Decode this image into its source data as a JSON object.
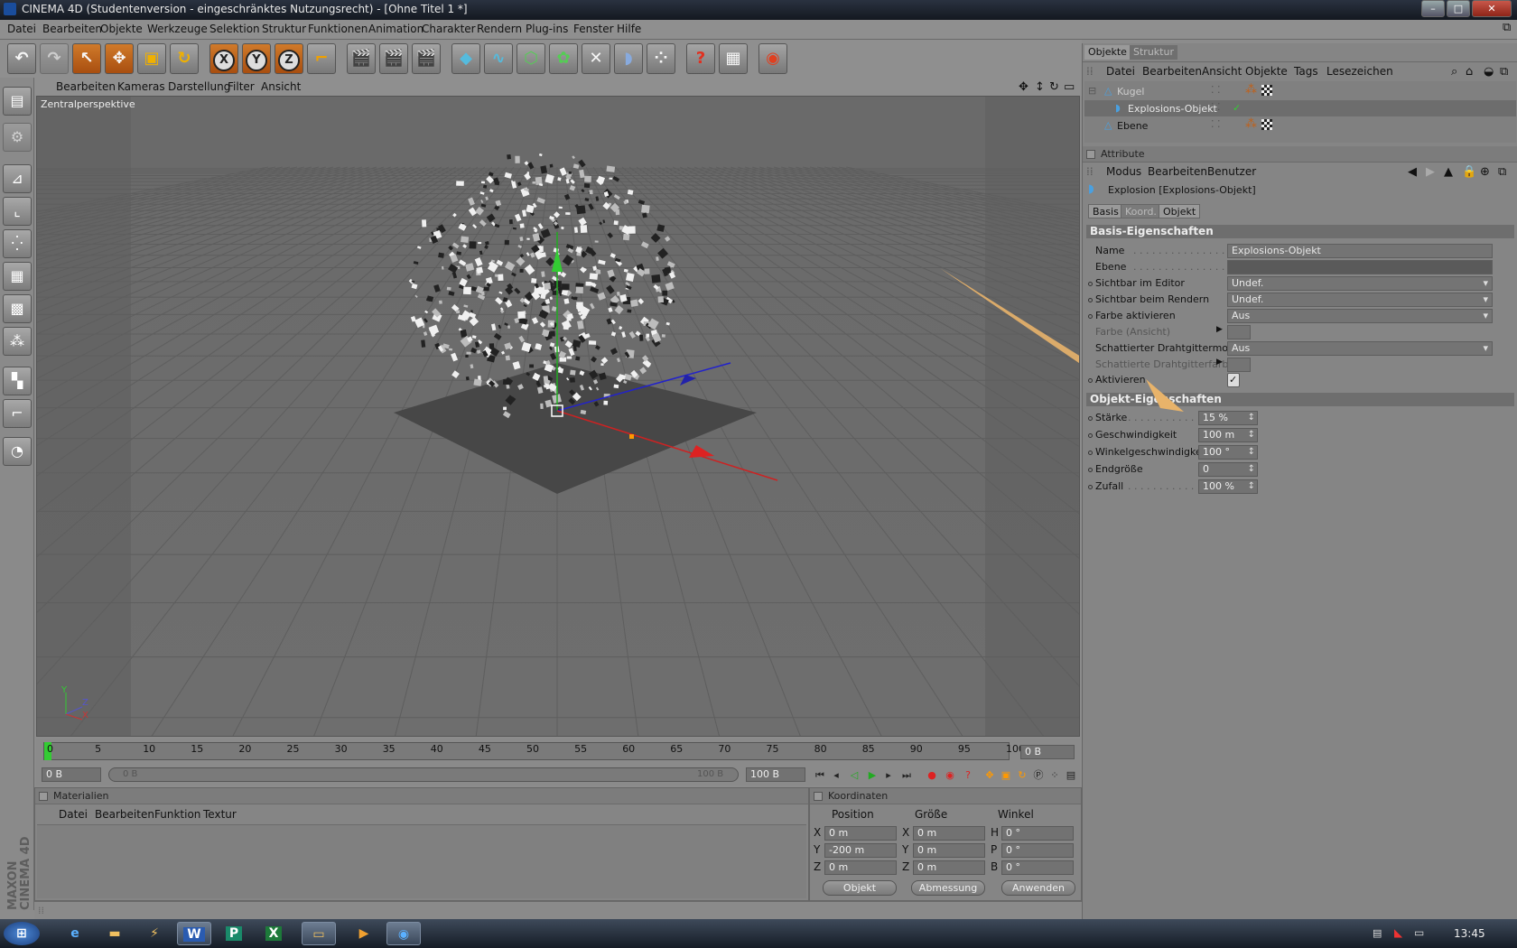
{
  "window": {
    "title": "CINEMA 4D (Studentenversion - eingeschränktes Nutzungsrecht) - [Ohne Titel 1 *]",
    "buttons": [
      "–",
      "□",
      "✕"
    ]
  },
  "menubar": {
    "items": [
      "Datei",
      "Bearbeiten",
      "Objekte",
      "Werkzeuge",
      "Selektion",
      "Struktur",
      "Funktionen",
      "Animation",
      "Charakter",
      "Rendern",
      "Plug-ins",
      "Fenster",
      "Hilfe"
    ]
  },
  "toolbar": {
    "axis_x": "X",
    "axis_y": "Y",
    "axis_z": "Z",
    "tools": [
      "undo-icon",
      "redo-icon",
      "select-arrow-icon",
      "move-icon",
      "scale-icon",
      "rotate-icon",
      "x-axis-icon",
      "y-axis-icon",
      "z-axis-icon",
      "coordinate-system-icon",
      "render-view-icon",
      "render-picture-icon",
      "render-settings-icon",
      "cube-icon",
      "spline-icon",
      "nurbs-icon",
      "modeling-icon",
      "deformer-icon",
      "scene-icon",
      "particle-icon",
      "help-icon",
      "script-icon",
      "browser-icon"
    ]
  },
  "viewport": {
    "menu": [
      "Bearbeiten",
      "Kameras",
      "Darstellung",
      "Filter",
      "Ansicht"
    ],
    "label": "Zentralperspektive",
    "axis_y": "Y",
    "axis_z": "Z",
    "axis_x": "X"
  },
  "timeline": {
    "ticks": [
      "0",
      "5",
      "10",
      "15",
      "20",
      "25",
      "30",
      "35",
      "40",
      "45",
      "50",
      "55",
      "60",
      "65",
      "70",
      "75",
      "80",
      "85",
      "90",
      "95",
      "100"
    ],
    "current_frame": "0 B",
    "start": "0 B",
    "slider_start": "0 B",
    "slider_end": "100 B",
    "end": "100 B"
  },
  "materials": {
    "title": "Materialien",
    "menu": [
      "Datei",
      "Bearbeiten",
      "Funktion",
      "Textur"
    ]
  },
  "coordinates": {
    "title": "Koordinaten",
    "headers": [
      "Position",
      "Größe",
      "Winkel"
    ],
    "rows": [
      {
        "axis": "X",
        "pos": "0 m",
        "size_axis": "X",
        "size": "0 m",
        "rot_axis": "H",
        "rot": "0 °"
      },
      {
        "axis": "Y",
        "pos": "-200 m",
        "size_axis": "Y",
        "size": "0 m",
        "rot_axis": "P",
        "rot": "0 °"
      },
      {
        "axis": "Z",
        "pos": "0 m",
        "size_axis": "Z",
        "size": "0 m",
        "rot_axis": "B",
        "rot": "0 °"
      }
    ],
    "mode": "Objekt",
    "size_mode": "Abmessung",
    "apply": "Anwenden"
  },
  "object_manager": {
    "tabs": [
      "Objekte",
      "Struktur"
    ],
    "menu": [
      "Datei",
      "Bearbeiten",
      "Ansicht",
      "Objekte",
      "Tags",
      "Lesezeichen"
    ],
    "objects": [
      {
        "name": "Kugel"
      },
      {
        "name": "Explosions-Objekt"
      },
      {
        "name": "Ebene"
      }
    ]
  },
  "attributes": {
    "title": "Attribute",
    "menu": [
      "Modus",
      "Bearbeiten",
      "Benutzer"
    ],
    "object_title": "Explosion [Explosions-Objekt]",
    "tabs": [
      "Basis",
      "Koord.",
      "Objekt"
    ],
    "basis_section": "Basis-Eigenschaften",
    "basis": [
      {
        "label": "Name",
        "value": "Explosions-Objekt"
      },
      {
        "label": "Ebene",
        "value": ""
      },
      {
        "label": "Sichtbar im Editor",
        "value": "Undef."
      },
      {
        "label": "Sichtbar beim Rendern",
        "value": "Undef."
      },
      {
        "label": "Farbe aktivieren",
        "value": "Aus"
      },
      {
        "label": "Farbe (Ansicht)",
        "value": ""
      },
      {
        "label": "Schattierter Drahtgittermodus",
        "value": "Aus"
      },
      {
        "label": "Schattierte Drahtgitterfarbe",
        "value": ""
      },
      {
        "label": "Aktivieren",
        "value": "✓"
      }
    ],
    "object_section": "Objekt-Eigenschaften",
    "props": [
      {
        "label": "Stärke",
        "value": "15 %"
      },
      {
        "label": "Geschwindigkeit",
        "value": "100 m"
      },
      {
        "label": "Winkelgeschwindigkeit",
        "value": "100 °"
      },
      {
        "label": "Endgröße",
        "value": "0"
      },
      {
        "label": "Zufall",
        "value": "100 %"
      }
    ]
  },
  "brand": {
    "line1": "MAXON",
    "line2": "CINEMA 4D"
  },
  "taskbar": {
    "apps": [
      "start-orb-icon",
      "internet-explorer-icon",
      "explorer-icon",
      "winamp-icon",
      "word-icon",
      "publisher-icon",
      "excel-icon",
      "folder-icon",
      "media-icon",
      "cinema4d-icon"
    ],
    "app_letters": {
      "word": "W",
      "publisher": "P",
      "excel": "X"
    },
    "clock": "13:45"
  },
  "colors": {
    "accent_orange": "#d07a2a",
    "annotation_arrow": "#e8b36a",
    "panel_section": "#6e6e6e"
  }
}
